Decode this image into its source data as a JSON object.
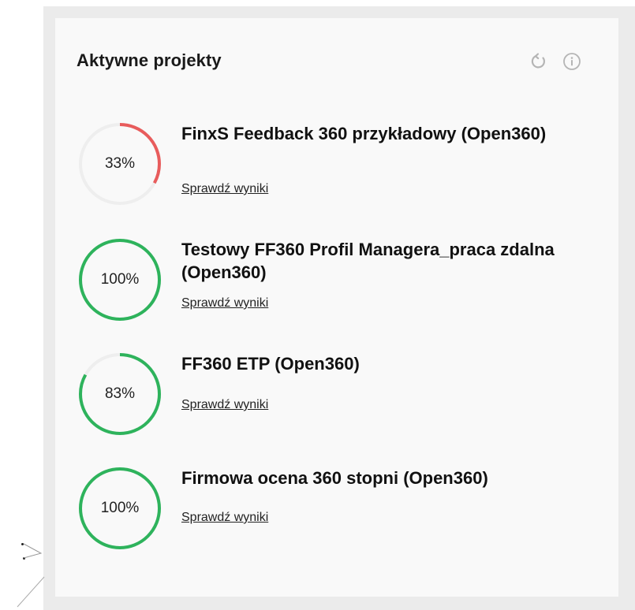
{
  "widget": {
    "title": "Aktywne projekty",
    "icons": {
      "refresh": "refresh-icon",
      "info": "info-icon"
    }
  },
  "colors": {
    "complete": "#2eb35c",
    "low": "#e85c5c",
    "track": "#eeeeee",
    "frame": "#ebebeb",
    "card": "#f9f9f9"
  },
  "projects": [
    {
      "title": "FinxS Feedback 360 przykładowy (Open360)",
      "percent_label": "33%",
      "percent": 33,
      "link": "Sprawdź wyniki"
    },
    {
      "title": "Testowy FF360 Profil Managera_praca zdalna (Open360)",
      "percent_label": "100%",
      "percent": 100,
      "link": "Sprawdź wyniki"
    },
    {
      "title": "FF360 ETP (Open360)",
      "percent_label": "83%",
      "percent": 83,
      "link": "Sprawdź wyniki"
    },
    {
      "title": "Firmowa ocena 360 stopni (Open360)",
      "percent_label": "100%",
      "percent": 100,
      "link": "Sprawdź wyniki"
    }
  ]
}
